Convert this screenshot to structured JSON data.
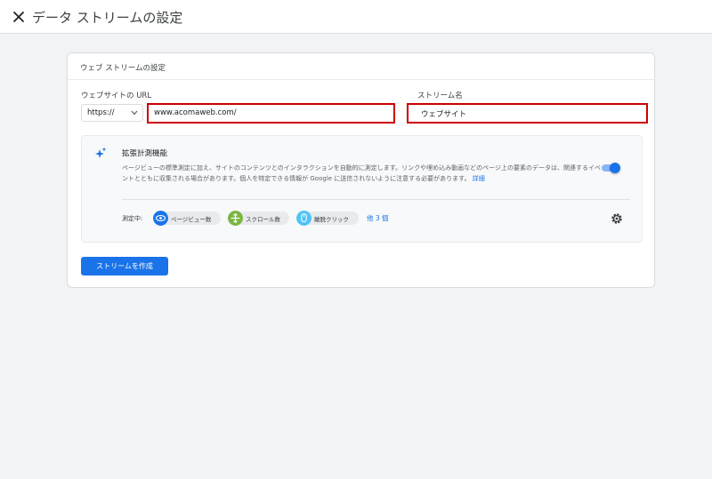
{
  "header": {
    "title": "データ ストリームの設定",
    "close_icon": "close-icon"
  },
  "card": {
    "title": "ウェブ ストリームの設定",
    "url_label": "ウェブサイトの URL",
    "protocol": {
      "selected": "https://",
      "icon": "caret-down-icon"
    },
    "url_value": "www.acomaweb.com/",
    "stream_name_label": "ストリーム名",
    "stream_name_value": "ウェブサイト",
    "enhanced": {
      "icon": "sparkle-icon",
      "title": "拡張計測機能",
      "description": "ページビューの標準測定に加え、サイトのコンテンツとのインタラクションを自動的に測定します。リンクや埋め込み動画などのページ上の要素のデータは、関連するイベントとともに収集される場合があります。個人を特定できる情報が Google に送信されないように注意する必要があります。",
      "detail_link": "詳細",
      "toggle_on": true,
      "measuring_label": "測定中:",
      "chips": [
        {
          "label": "ページビュー数",
          "icon": "eye-icon",
          "color": "#1a73e8"
        },
        {
          "label": "スクロール数",
          "icon": "crosshair-icon",
          "color": "#7cb342"
        },
        {
          "label": "離脱クリック",
          "icon": "mouse-icon",
          "color": "#4fc3f7"
        }
      ],
      "more_link": "他 3 個",
      "settings_icon": "gear-icon"
    },
    "create_button": "ストリームを作成"
  },
  "colors": {
    "accent": "#1a73e8",
    "highlight_border": "#cc0000"
  }
}
